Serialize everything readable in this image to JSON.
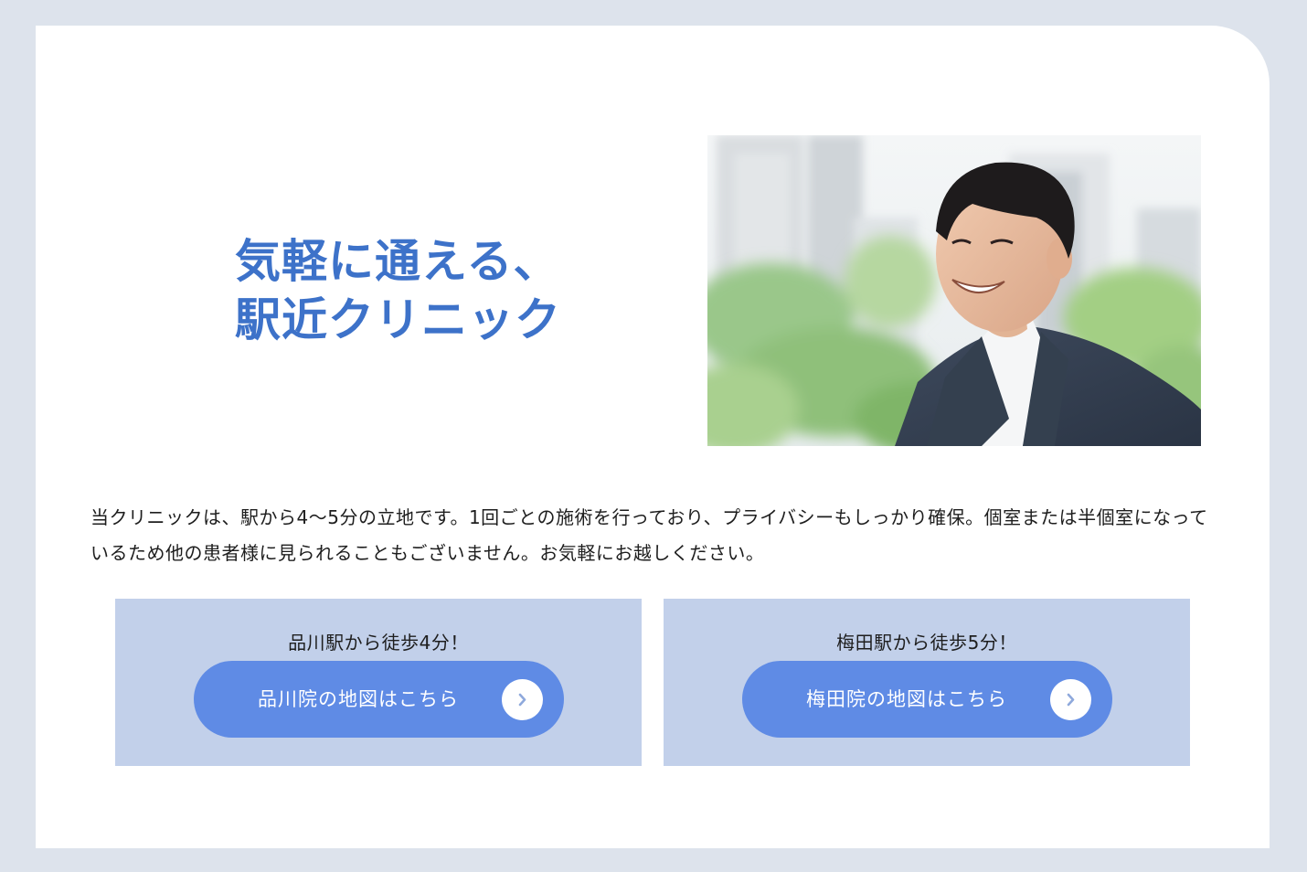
{
  "hero": {
    "headline_line1": "気軽に通える、",
    "headline_line2": "駅近クリニック",
    "photo_icon": "smiling-businessman-photo"
  },
  "intro": {
    "text": "当クリニックは、駅から4〜5分の立地です。1回ごとの施術を行っており、プライバシーもしっかり確保。個室または半個室になっているため他の患者様に見られることもございません。お気軽にお越しください。"
  },
  "access": [
    {
      "text": "品川駅から徒歩4分！",
      "button_label": "品川院の地図はこちら",
      "icon": "chevron-right-icon"
    },
    {
      "text": "梅田駅から徒歩5分！",
      "button_label": "梅田院の地図はこちら",
      "icon": "chevron-right-icon"
    }
  ],
  "colors": {
    "page_background": "#dde3ec",
    "card_background": "#ffffff",
    "headline": "#3d72c9",
    "access_box": "#c2d0ea",
    "button": "#5f8be5",
    "button_text": "#ffffff"
  }
}
